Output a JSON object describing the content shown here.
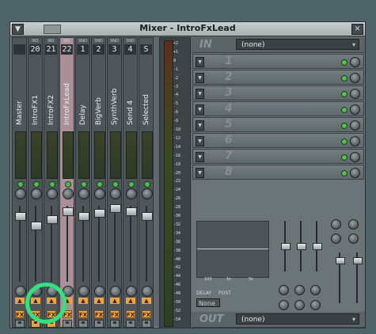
{
  "window": {
    "title": "Mixer - IntroFxLead",
    "menu_icon": "dropdown-arrow-icon",
    "close_icon": "close-icon"
  },
  "strips": [
    {
      "type": "",
      "num": "",
      "name": "Master",
      "selected": false,
      "save_on": false
    },
    {
      "type": "INS",
      "num": "20",
      "name": "IntroFX1",
      "selected": false,
      "save_on": true
    },
    {
      "type": "INS",
      "num": "21",
      "name": "IntroFX2",
      "selected": false,
      "save_on": true
    },
    {
      "type": "INS",
      "num": "22",
      "name": "IntroFxLead",
      "selected": true,
      "save_on": false
    },
    {
      "type": "SND",
      "num": "1",
      "name": "Delay",
      "selected": false,
      "save_on": false
    },
    {
      "type": "SND",
      "num": "2",
      "name": "BigVerb",
      "selected": false,
      "save_on": false
    },
    {
      "type": "SND",
      "num": "3",
      "name": "SynthVerb",
      "selected": false,
      "save_on": false
    },
    {
      "type": "SND",
      "num": "4",
      "name": "Send 4",
      "selected": false,
      "save_on": false
    },
    {
      "type": "",
      "num": "S",
      "name": "Selected",
      "selected": false,
      "save_on": false
    }
  ],
  "fx_label": "FX",
  "db_scale": [
    "+2",
    "+1",
    "0",
    "-1",
    "-2",
    "-3",
    "-4",
    "-5",
    "-6",
    "-8",
    "-10",
    "-12",
    "-14",
    "-16",
    "-18",
    "-20",
    "-22",
    "-24",
    "-26",
    "-28",
    "-30",
    "-32",
    "-34",
    "-36",
    "-38",
    "-40",
    "-42",
    "-44",
    "-46",
    "-48",
    "-50",
    "-52",
    "-54"
  ],
  "input": {
    "label": "IN",
    "value": "(none)"
  },
  "output": {
    "label": "OUT",
    "value": "(none)"
  },
  "fx_slots": [
    "1",
    "2",
    "3",
    "4",
    "5",
    "6",
    "7",
    "8"
  ],
  "eq": {
    "labels": [
      "100",
      "1k",
      "5k"
    ]
  },
  "delay": {
    "label": "DELAY",
    "post": "POST",
    "value": "None"
  },
  "colors": {
    "accent": "#f0a33a",
    "led": "#4fbd4a",
    "highlight": "#2ee47e"
  }
}
